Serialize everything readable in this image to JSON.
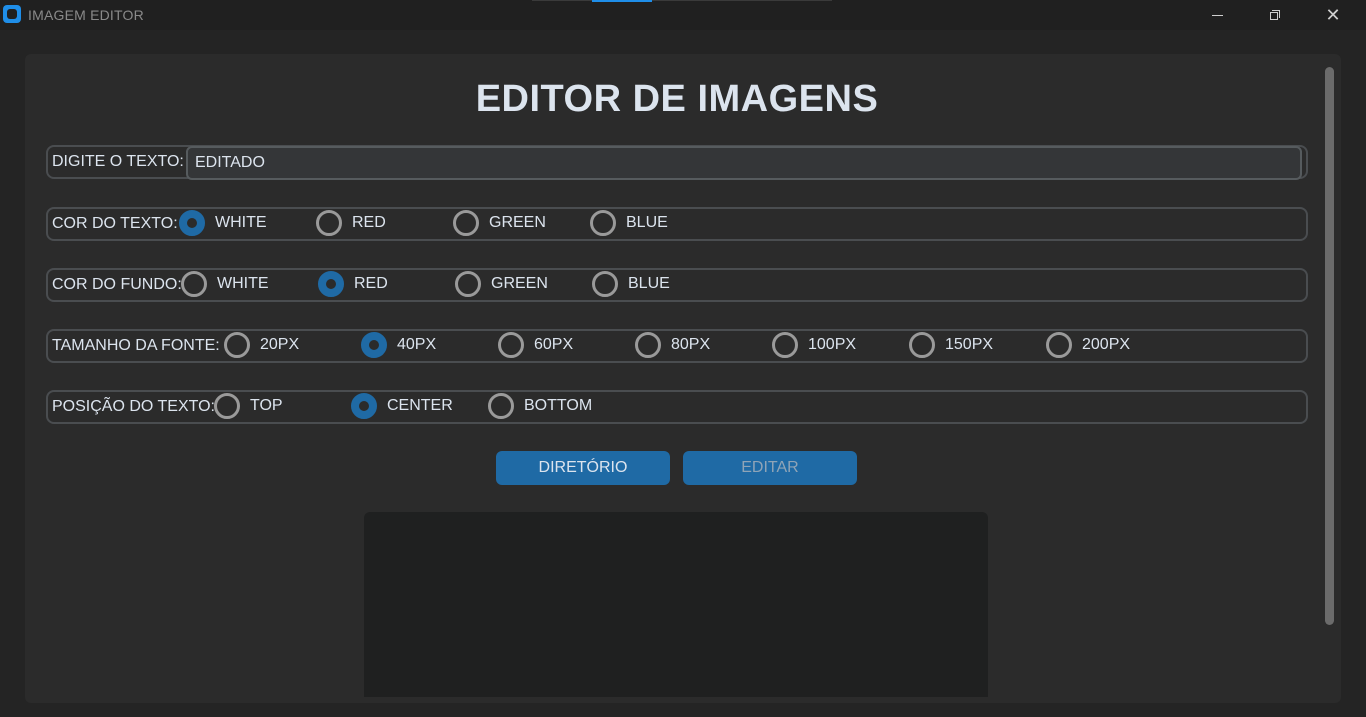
{
  "window": {
    "title": "IMAGEM EDITOR"
  },
  "page": {
    "title": "EDITOR DE IMAGENS"
  },
  "text_input": {
    "label": "DIGITE O TEXTO:",
    "value": "EDITADO"
  },
  "text_color": {
    "label": "COR DO TEXTO:",
    "options": [
      "WHITE",
      "RED",
      "GREEN",
      "BLUE"
    ],
    "selected": "WHITE"
  },
  "bg_color": {
    "label": "COR DO FUNDO:",
    "options": [
      "WHITE",
      "RED",
      "GREEN",
      "BLUE"
    ],
    "selected": "RED"
  },
  "font_size": {
    "label": "TAMANHO DA FONTE:",
    "options": [
      "20PX",
      "40PX",
      "60PX",
      "80PX",
      "100PX",
      "150PX",
      "200PX"
    ],
    "selected": "40PX"
  },
  "text_position": {
    "label": "POSIÇÃO DO TEXTO:",
    "options": [
      "TOP",
      "CENTER",
      "BOTTOM"
    ],
    "selected": "CENTER"
  },
  "buttons": {
    "directory": "DIRETÓRIO",
    "edit": "EDITAR"
  },
  "colors": {
    "accent": "#1f6aa5",
    "app_icon": "#1f8ee8",
    "background": "#2b2b2b"
  }
}
